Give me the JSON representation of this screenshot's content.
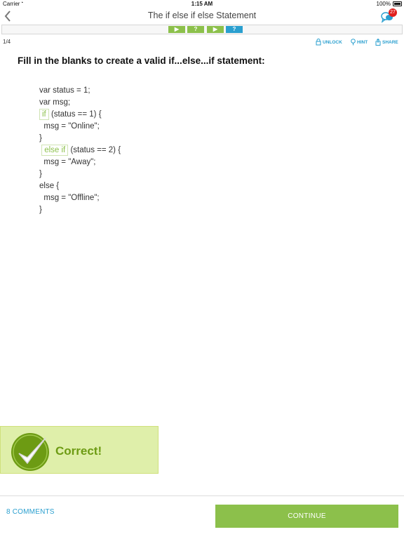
{
  "status_bar": {
    "carrier": "Carrier",
    "time": "1:15 AM",
    "battery": "100%"
  },
  "nav": {
    "title": "The if else if else Statement",
    "badge": "27"
  },
  "steps": [
    {
      "label": "▶",
      "color": "#8cc04b"
    },
    {
      "label": "?",
      "color": "#8cc04b"
    },
    {
      "label": "▶",
      "color": "#8cc04b"
    },
    {
      "label": "?",
      "color": "#2a9fcf"
    }
  ],
  "page_counter": "1/4",
  "actions": {
    "unlock": "UNLOCK",
    "hint": "HINT",
    "share": "SHARE"
  },
  "question": "Fill in the blanks to create a valid if...else...if statement:",
  "code": {
    "line1": "var status = 1;",
    "line2": "var msg;",
    "blank1": "if",
    "line3_rest": " (status == 1) {",
    "line4": "  msg = \"Online\";",
    "line5": "}",
    "blank2": "else if",
    "line6_rest": " (status == 2) {",
    "line7": "  msg = \"Away\";",
    "line8": "}",
    "line9": "else {",
    "line10": "  msg = \"Offline\";",
    "line11": "}"
  },
  "result": {
    "text": "Correct!"
  },
  "footer": {
    "comments": "8 COMMENTS",
    "continue": "CONTINUE"
  },
  "colors": {
    "accent": "#2a9fcf",
    "success": "#8cc04b",
    "badge": "#e0201e"
  }
}
